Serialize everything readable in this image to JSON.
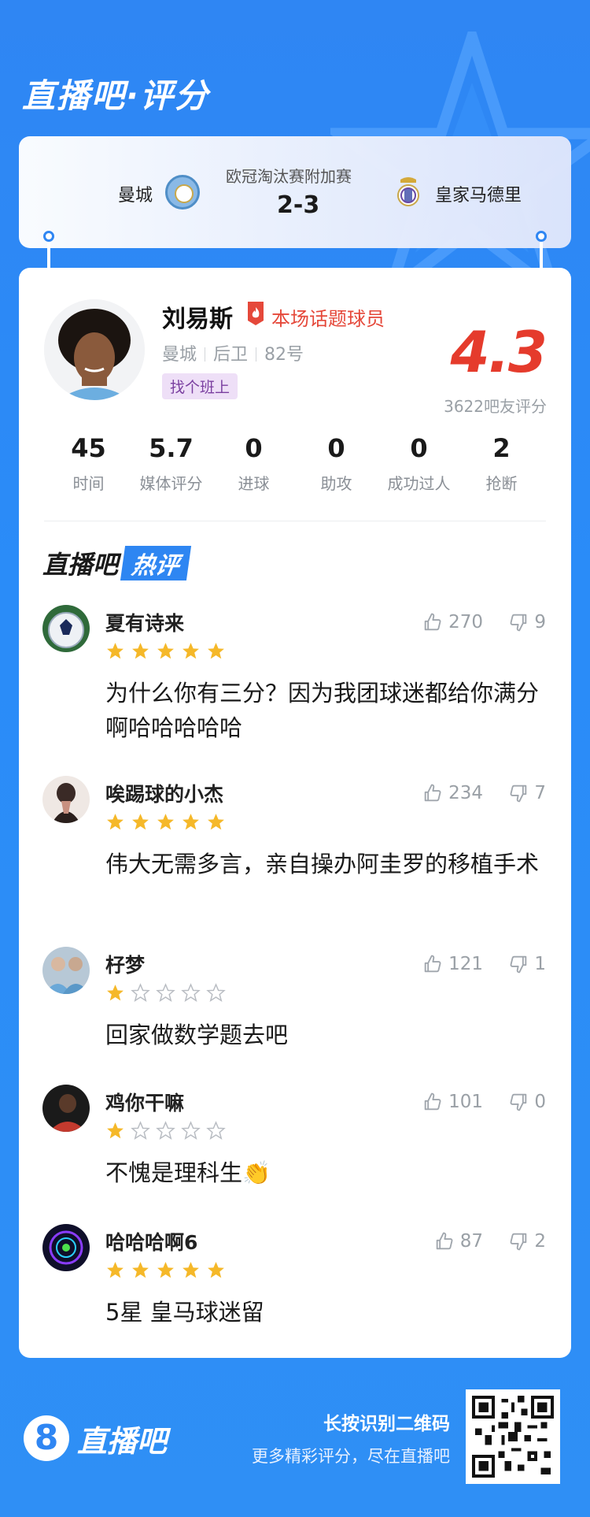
{
  "header": {
    "brand_title": "直播吧·评分"
  },
  "match": {
    "home_team": "曼城",
    "away_team": "皇家马德里",
    "competition": "欧冠淘汰赛附加赛",
    "score": "2-3"
  },
  "player": {
    "name": "刘易斯",
    "hot_label": "本场话题球员",
    "team": "曼城",
    "position": "后卫",
    "number": "82号",
    "tag": "找个班上",
    "rating": "4.3",
    "rating_count": "3622吧友评分"
  },
  "stats": [
    {
      "value": "45",
      "label": "时间"
    },
    {
      "value": "5.7",
      "label": "媒体评分"
    },
    {
      "value": "0",
      "label": "进球"
    },
    {
      "value": "0",
      "label": "助攻"
    },
    {
      "value": "0",
      "label": "成功过人"
    },
    {
      "value": "2",
      "label": "抢断"
    }
  ],
  "hot_section": {
    "title_a": "直播吧",
    "title_b": "热评"
  },
  "comments": [
    {
      "user": "夏有诗来",
      "stars": 5,
      "likes": "270",
      "dislikes": "9",
      "text": "为什么你有三分？因为我团球迷都给你满分啊哈哈哈哈哈"
    },
    {
      "user": "唉踢球的小杰",
      "stars": 5,
      "likes": "234",
      "dislikes": "7",
      "text": "伟大无需多言，亲自操办阿圭罗的移植手术"
    },
    {
      "user": "杍梦",
      "stars": 1,
      "likes": "121",
      "dislikes": "1",
      "text": "回家做数学题去吧"
    },
    {
      "user": "鸡你干嘛",
      "stars": 1,
      "likes": "101",
      "dislikes": "0",
      "text": "不愧是理科生👏"
    },
    {
      "user": "哈哈哈啊6",
      "stars": 5,
      "likes": "87",
      "dislikes": "2",
      "text": "5星 皇马球迷留"
    }
  ],
  "footer": {
    "logo_digit": "8",
    "logo_text": "直播吧",
    "line1": "长按识别二维码",
    "line2": "更多精彩评分，尽在直播吧"
  },
  "colors": {
    "brand_blue": "#2f86f3",
    "rating_red": "#e53b2c",
    "star_gold": "#f5b829",
    "tag_bg": "#eedff7"
  }
}
